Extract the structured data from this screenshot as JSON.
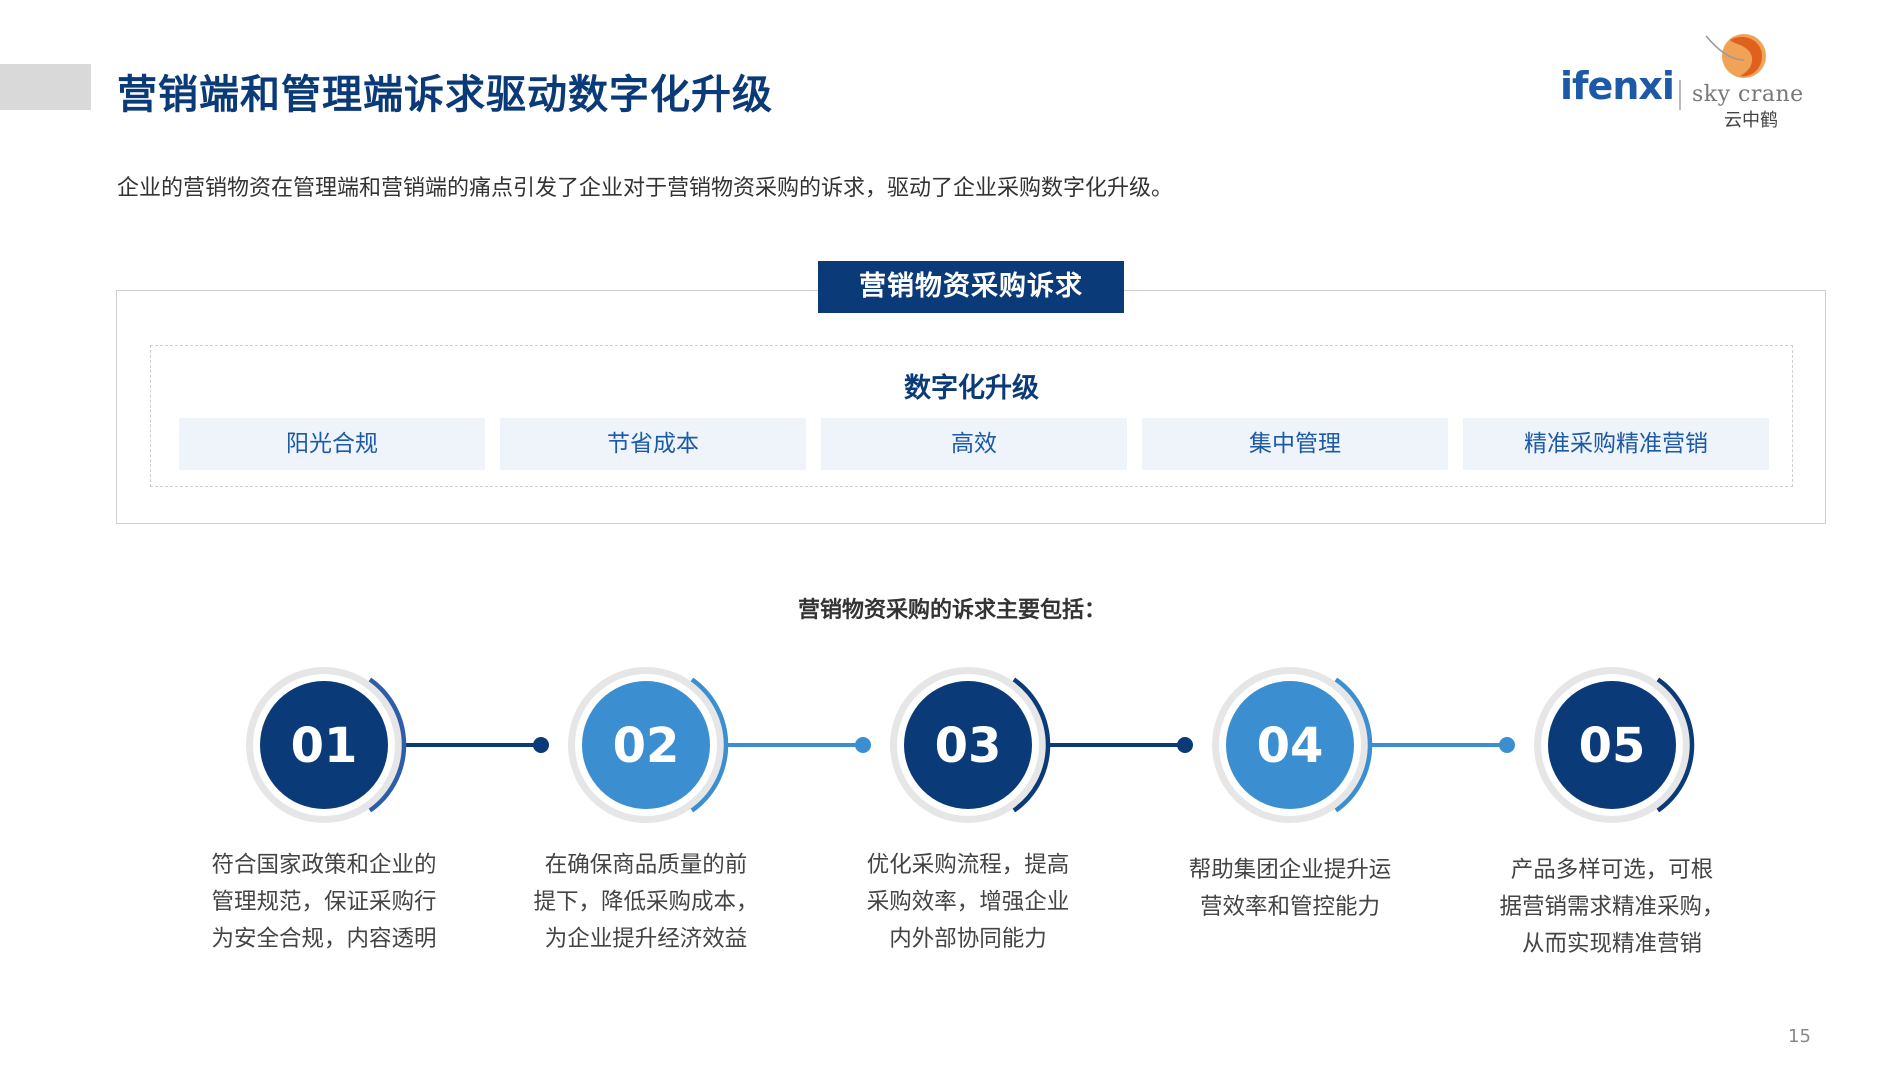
{
  "header": {
    "title": "营销端和管理端诉求驱动数字化升级",
    "logo_primary": "ifenxi",
    "logo_secondary": "sky crane",
    "logo_secondary_cn": "云中鹤"
  },
  "intro": "企业的营销物资在管理端和营销端的痛点引发了企业对于营销物资采购的诉求，驱动了企业采购数字化升级。",
  "demand_box": {
    "tag": "营销物资采购诉求",
    "title": "数字化升级",
    "features": [
      "阳光合规",
      "节省成本",
      "高效",
      "集中管理",
      "精准采购精准营销"
    ]
  },
  "subtitle": "营销物资采购的诉求主要包括：",
  "steps": [
    {
      "num": "01",
      "color": "#0b3a78",
      "arc": "#2f5ea8",
      "lines": [
        "符合国家政策和企业的",
        "管理规范，保证采购行",
        "为安全合规，内容透明"
      ]
    },
    {
      "num": "02",
      "color": "#3b8fd1",
      "arc": "#3b8fd1",
      "lines": [
        "在确保商品质量的前",
        "提下，降低采购成本，",
        "为企业提升经济效益"
      ]
    },
    {
      "num": "03",
      "color": "#0b3a78",
      "arc": "#0b3a78",
      "lines": [
        "优化采购流程，提高",
        "采购效率，增强企业",
        "内外部协同能力"
      ]
    },
    {
      "num": "04",
      "color": "#3b8fd1",
      "arc": "#3b8fd1",
      "lines": [
        "帮助集团企业提升运",
        "营效率和管控能力"
      ]
    },
    {
      "num": "05",
      "color": "#0b3a78",
      "arc": "#0b3a78",
      "lines": [
        "产品多样可选，可根",
        "据营销需求精准采购，",
        "从而实现精准营销"
      ]
    }
  ],
  "page_number": "15"
}
